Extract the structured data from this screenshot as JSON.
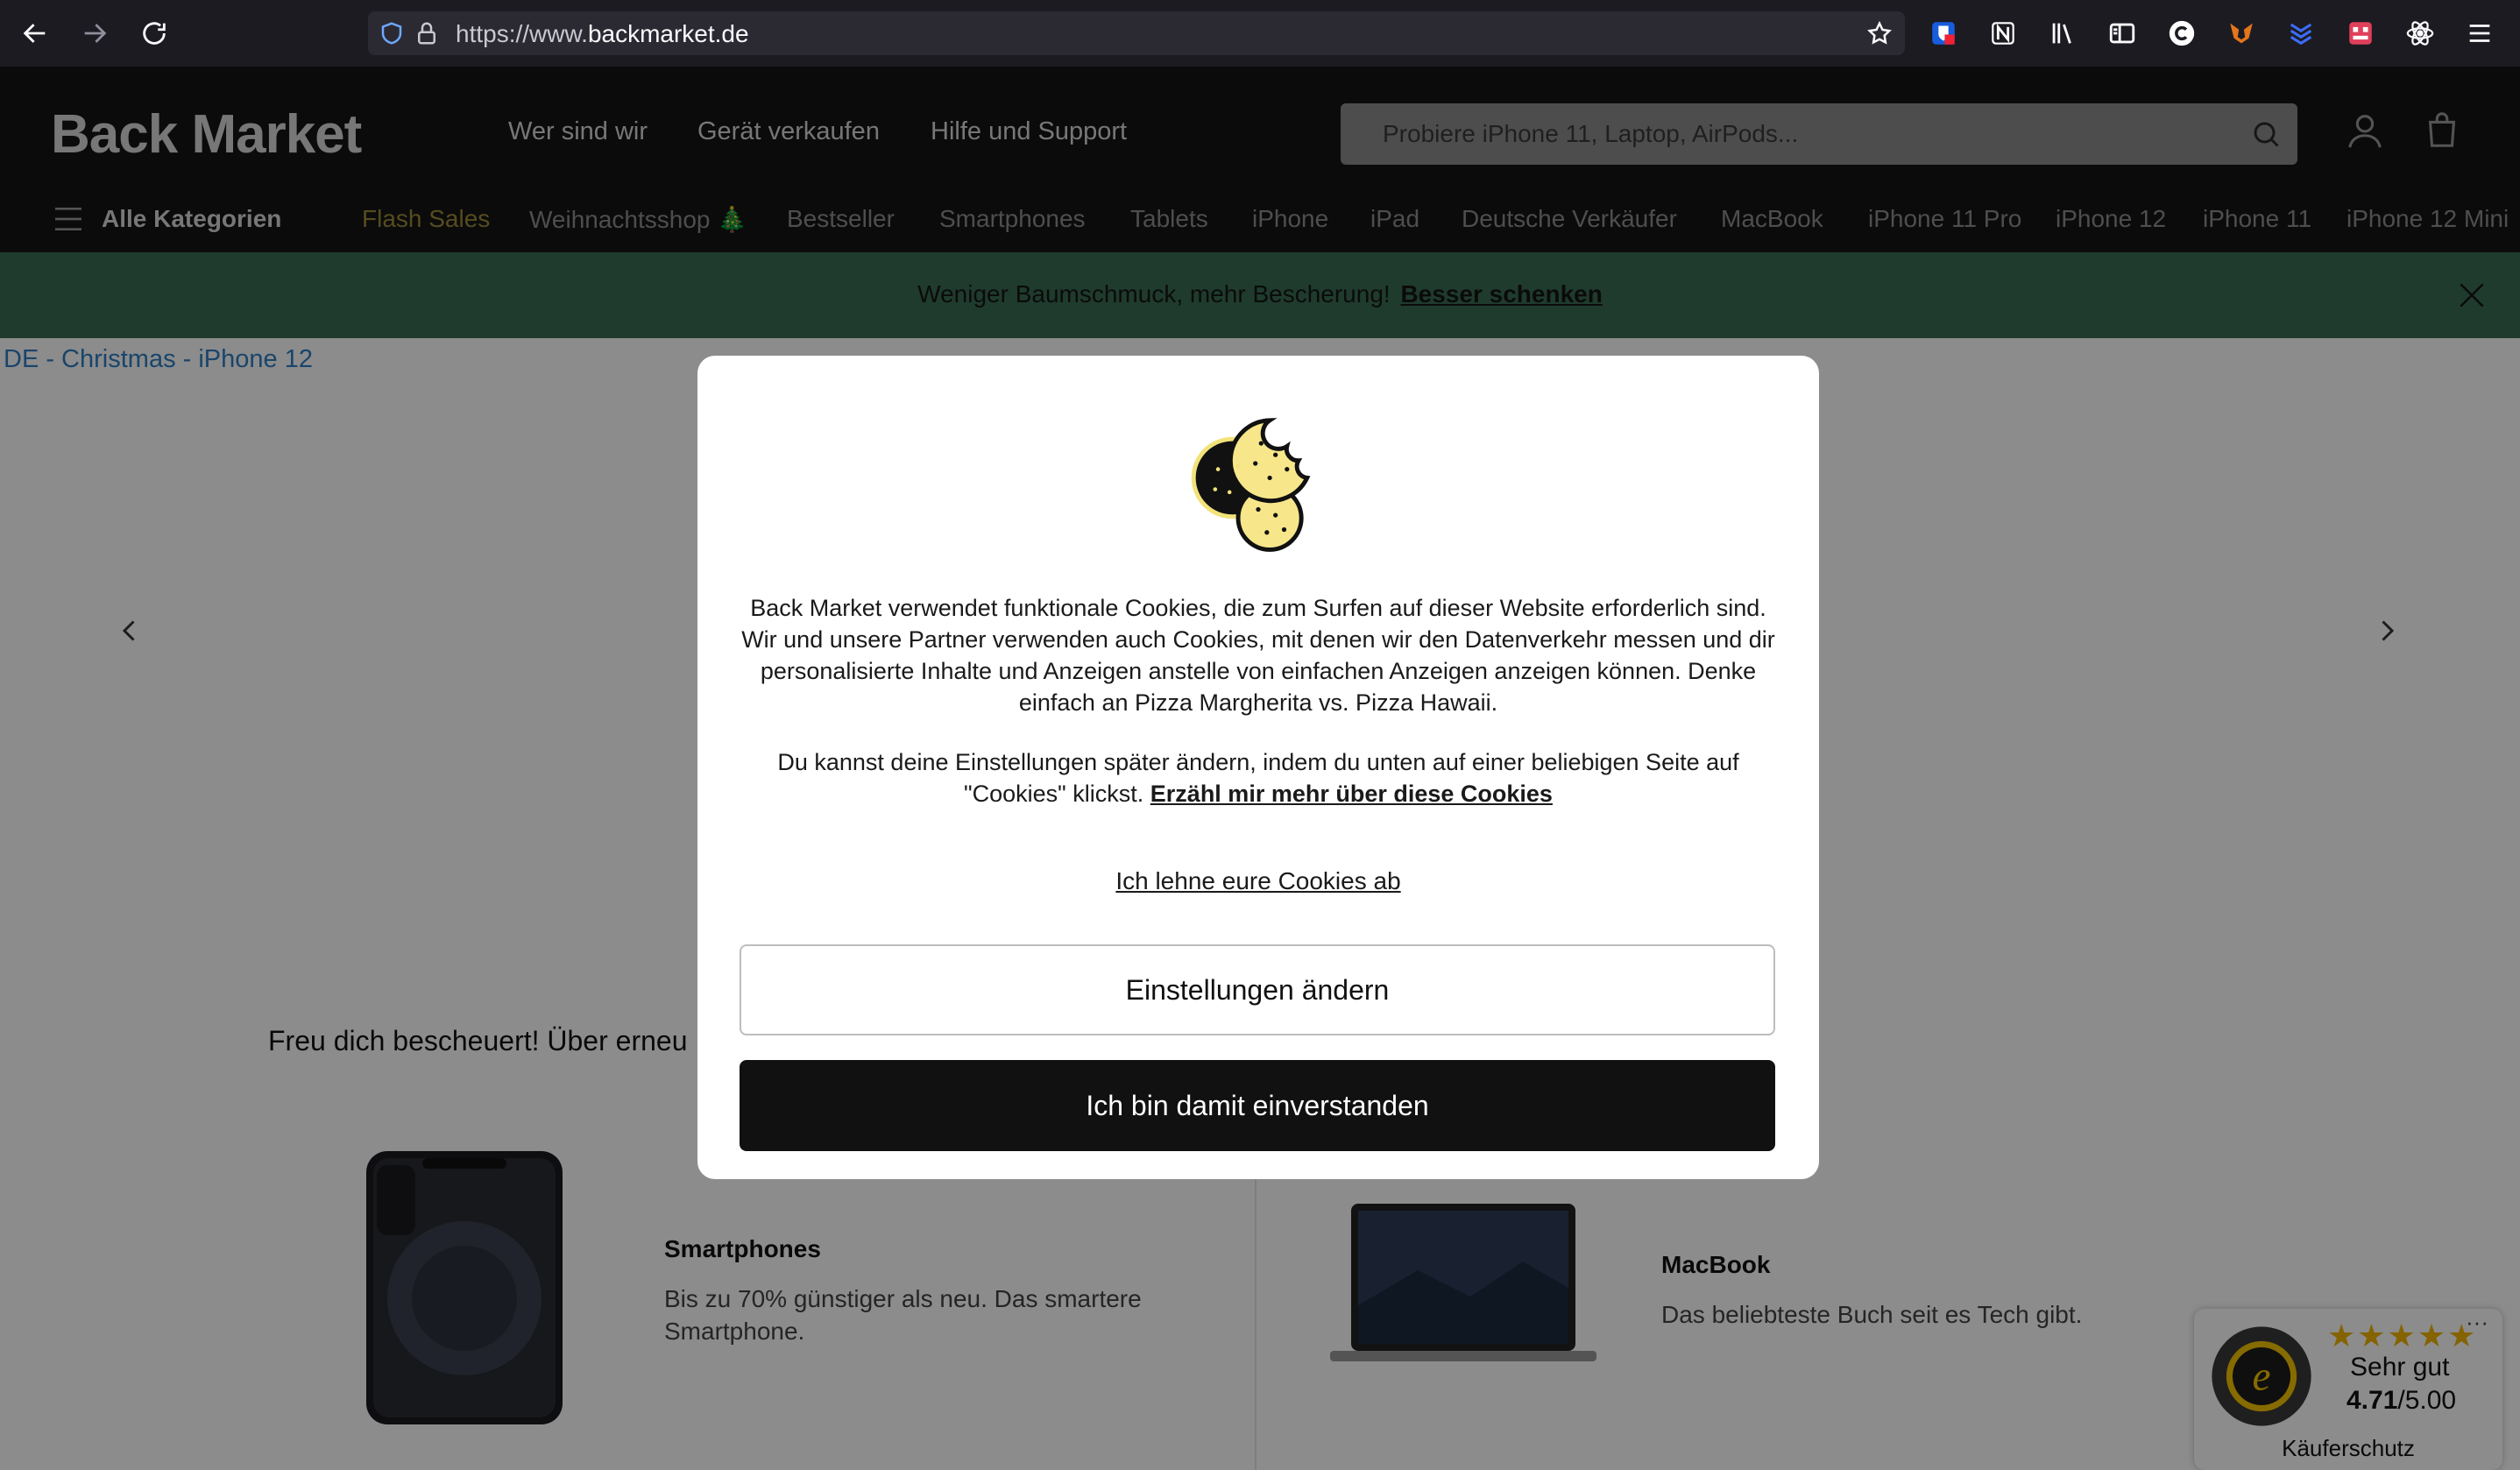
{
  "browser": {
    "url_prefix": "https://www.",
    "url_domain": "backmarket.de"
  },
  "header": {
    "logo": "Back Market",
    "links": [
      "Wer sind wir",
      "Gerät verkaufen",
      "Hilfe und Support"
    ],
    "search_placeholder": "Probiere iPhone 11, Laptop, AirPods...",
    "all_categories": "Alle Kategorien",
    "categories": [
      "Flash Sales",
      "Weihnachtsshop 🎄",
      "Bestseller",
      "Smartphones",
      "Tablets",
      "iPhone",
      "iPad",
      "Deutsche Verkäufer",
      "MacBook",
      "iPhone 11 Pro",
      "iPhone 12",
      "iPhone 11",
      "iPhone 12 Mini"
    ]
  },
  "promo": {
    "text": "Weniger Baumschmuck, mehr Bescherung!",
    "link": "Besser schenken"
  },
  "page": {
    "breadcrumb": "DE - Christmas - iPhone 12",
    "section_title": "Freu dich bescheuert! Über erneu",
    "cards": [
      {
        "title": "Smartphones",
        "desc": "Bis zu 70% günstiger als neu. Das smartere Smartphone."
      },
      {
        "title": "MacBook",
        "desc": "Das beliebteste Buch seit es Tech gibt."
      }
    ]
  },
  "trusted_shops": {
    "stars": "★★★★★",
    "rating_text": "Sehr gut",
    "score": "4.71",
    "score_max": "/5.00",
    "label": "Käuferschutz",
    "more": "···"
  },
  "cookie_modal": {
    "paragraph1": "Back Market verwendet funktionale Cookies, die zum Surfen auf dieser Website erforderlich sind. Wir und unsere Partner verwenden auch Cookies, mit denen wir den Datenverkehr messen und dir personalisierte Inhalte und Anzeigen anstelle von einfachen Anzeigen anzeigen können. Denke einfach an Pizza Margherita vs. Pizza Hawaii.",
    "paragraph2": "Du kannst deine Einstellungen später ändern, indem du unten auf einer beliebigen Seite auf \"Cookies\" klickst.",
    "learn_more": "Erzähl mir mehr über diese Cookies",
    "decline": "Ich lehne eure Cookies ab",
    "settings_button": "Einstellungen ändern",
    "accept_button": "Ich bin damit einverstanden"
  },
  "colors": {
    "accent_promo": "#3a6c54",
    "header_bg": "#141414",
    "accept_bg": "#111111",
    "breadcrumb": "#2f7fc4"
  }
}
